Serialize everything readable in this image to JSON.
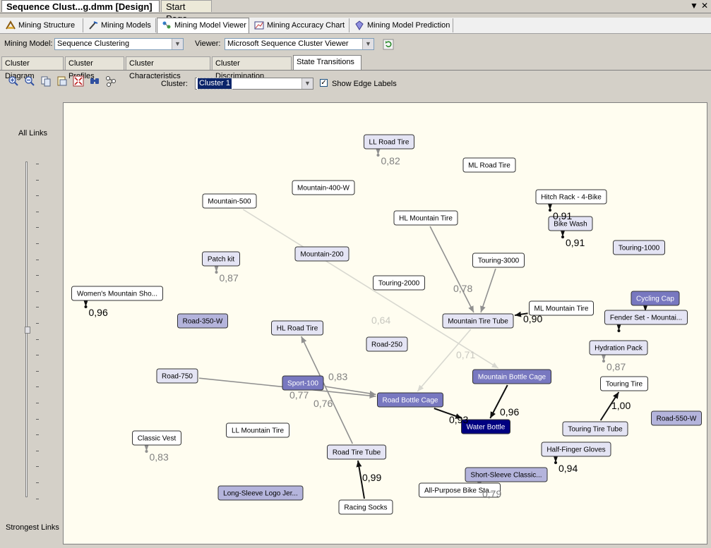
{
  "doc_tabs": {
    "active": "Sequence Clust...g.dmm [Design]",
    "inactive": "Start Page",
    "dropdown_glyph": "▼",
    "close_glyph": "✕"
  },
  "designer_tabs": [
    {
      "label": "Mining Structure",
      "icon": "mining-structure-icon"
    },
    {
      "label": "Mining Models",
      "icon": "mining-models-icon"
    },
    {
      "label": "Mining Model Viewer",
      "icon": "mining-model-viewer-icon"
    },
    {
      "label": "Mining Accuracy Chart",
      "icon": "accuracy-chart-icon"
    },
    {
      "label": "Mining Model Prediction",
      "icon": "prediction-icon"
    }
  ],
  "model_bar": {
    "model_label": "Mining Model:",
    "model_value": "Sequence Clustering",
    "viewer_label": "Viewer:",
    "viewer_value": "Microsoft Sequence Cluster Viewer"
  },
  "view_tabs": [
    "Cluster Diagram",
    "Cluster Profiles",
    "Cluster Characteristics",
    "Cluster Discrimination",
    "State Transitions"
  ],
  "toolbar": {
    "cluster_label": "Cluster:",
    "cluster_value": "Cluster 1",
    "show_edge_labels": "Show Edge Labels",
    "show_edge_labels_checked": true,
    "icons": [
      "zoom-in-icon",
      "zoom-out-icon",
      "copy-icon",
      "copy-selection-icon",
      "fit-to-window-icon",
      "find-node-icon",
      "layout-icon"
    ]
  },
  "links_slider": {
    "top_label": "All Links",
    "bottom_label": "Strongest Links",
    "level": 0.5
  },
  "colors": {
    "node_white": "#ffffff",
    "node_light": "#e4e4f4",
    "node_medium": "#b4b4dc",
    "node_strong": "#7878c0",
    "node_selected": "#000080",
    "edge_dark": "#101010",
    "edge_gray": "#909090",
    "edge_light": "#d8d8d0"
  },
  "nodes": [
    {
      "id": "ll-road-tire",
      "label": "LL Road Tire",
      "shade": "light"
    },
    {
      "id": "ml-road-tire",
      "label": "ML Road Tire",
      "shade": "white"
    },
    {
      "id": "mountain-400-w",
      "label": "Mountain-400-W",
      "shade": "white"
    },
    {
      "id": "mountain-500",
      "label": "Mountain-500",
      "shade": "white"
    },
    {
      "id": "hitch-rack",
      "label": "Hitch Rack - 4-Bike",
      "shade": "white"
    },
    {
      "id": "hl-mountain-tire",
      "label": "HL Mountain Tire",
      "shade": "white"
    },
    {
      "id": "bike-wash",
      "label": "Bike Wash",
      "shade": "light"
    },
    {
      "id": "touring-1000",
      "label": "Touring-1000",
      "shade": "light"
    },
    {
      "id": "patch-kit",
      "label": "Patch kit",
      "shade": "light"
    },
    {
      "id": "mountain-200",
      "label": "Mountain-200",
      "shade": "light"
    },
    {
      "id": "touring-3000",
      "label": "Touring-3000",
      "shade": "white"
    },
    {
      "id": "touring-2000",
      "label": "Touring-2000",
      "shade": "white"
    },
    {
      "id": "womens-mountain-shorts",
      "label": "Women's Mountain Sho...",
      "shade": "white"
    },
    {
      "id": "cycling-cap",
      "label": "Cycling Cap",
      "shade": "strong"
    },
    {
      "id": "ml-mountain-tire",
      "label": "ML Mountain Tire",
      "shade": "white"
    },
    {
      "id": "fender-set",
      "label": "Fender Set - Mountai...",
      "shade": "light"
    },
    {
      "id": "road-350-w",
      "label": "Road-350-W",
      "shade": "medium"
    },
    {
      "id": "hl-road-tire",
      "label": "HL Road Tire",
      "shade": "light"
    },
    {
      "id": "mountain-tire-tube",
      "label": "Mountain Tire Tube",
      "shade": "light"
    },
    {
      "id": "road-250",
      "label": "Road-250",
      "shade": "light"
    },
    {
      "id": "hydration-pack",
      "label": "Hydration Pack",
      "shade": "light"
    },
    {
      "id": "road-750",
      "label": "Road-750",
      "shade": "light"
    },
    {
      "id": "sport-100",
      "label": "Sport-100",
      "shade": "strong"
    },
    {
      "id": "mountain-bottle-cage",
      "label": "Mountain Bottle Cage",
      "shade": "strong"
    },
    {
      "id": "touring-tire",
      "label": "Touring Tire",
      "shade": "white"
    },
    {
      "id": "road-bottle-cage",
      "label": "Road Bottle Cage",
      "shade": "strong"
    },
    {
      "id": "water-bottle",
      "label": "Water Bottle",
      "shade": "selected"
    },
    {
      "id": "road-550-w",
      "label": "Road-550-W",
      "shade": "medium"
    },
    {
      "id": "classic-vest",
      "label": "Classic Vest",
      "shade": "white"
    },
    {
      "id": "ll-mountain-tire",
      "label": "LL Mountain Tire",
      "shade": "white"
    },
    {
      "id": "touring-tire-tube",
      "label": "Touring Tire Tube",
      "shade": "light"
    },
    {
      "id": "half-finger-gloves",
      "label": "Half-Finger Gloves",
      "shade": "light"
    },
    {
      "id": "road-tire-tube",
      "label": "Road Tire Tube",
      "shade": "light"
    },
    {
      "id": "short-sleeve-classic",
      "label": "Short-Sleeve Classic...",
      "shade": "medium"
    },
    {
      "id": "all-purpose-bike-stand",
      "label": "All-Purpose Bike Sta...",
      "shade": "white"
    },
    {
      "id": "long-sleeve-logo-jersey",
      "label": "Long-Sleeve Logo Jer...",
      "shade": "medium"
    },
    {
      "id": "racing-socks",
      "label": "Racing Socks",
      "shade": "white"
    }
  ],
  "edges": [
    {
      "from": "mountain-500",
      "to": "mountain-bottle-cage",
      "label": "0,71",
      "strength": "light"
    },
    {
      "from": "hl-mountain-tire",
      "to": "mountain-tire-tube",
      "label": "0,78",
      "strength": "gray"
    },
    {
      "from": "touring-3000",
      "to": "mountain-tire-tube",
      "label": "",
      "strength": "gray"
    },
    {
      "from": "ml-mountain-tire",
      "to": "mountain-tire-tube",
      "label": "0,90",
      "strength": "dark"
    },
    {
      "from": "mountain-tire-tube",
      "to": "road-bottle-cage",
      "label": "0,64",
      "strength": "light"
    },
    {
      "from": "road-750",
      "to": "road-bottle-cage",
      "label": "0,77",
      "strength": "gray"
    },
    {
      "from": "sport-100",
      "to": "road-bottle-cage",
      "label": "0,76",
      "strength": "gray"
    },
    {
      "from": "road-tire-tube",
      "to": "hl-road-tire",
      "label": "0,83",
      "strength": "gray"
    },
    {
      "from": "racing-socks",
      "to": "road-tire-tube",
      "label": "0,99",
      "strength": "dark"
    },
    {
      "from": "road-bottle-cage",
      "to": "water-bottle",
      "label": "0,93",
      "strength": "dark"
    },
    {
      "from": "mountain-bottle-cage",
      "to": "water-bottle",
      "label": "0,96",
      "strength": "dark"
    },
    {
      "from": "touring-tire-tube",
      "to": "touring-tire",
      "label": "1,00",
      "strength": "dark"
    }
  ],
  "self_loops": [
    {
      "node": "ll-road-tire",
      "label": "0,82",
      "strength": "gray"
    },
    {
      "node": "hitch-rack",
      "label": "0,91",
      "strength": "dark"
    },
    {
      "node": "bike-wash",
      "label": "0,91",
      "strength": "dark"
    },
    {
      "node": "patch-kit",
      "label": "0,87",
      "strength": "gray"
    },
    {
      "node": "womens-mountain-shorts",
      "label": "0,96",
      "strength": "dark"
    },
    {
      "node": "hydration-pack",
      "label": "0,87",
      "strength": "gray"
    },
    {
      "node": "classic-vest",
      "label": "0,83",
      "strength": "gray"
    },
    {
      "node": "half-finger-gloves",
      "label": "0,94",
      "strength": "dark"
    },
    {
      "node": "short-sleeve-classic",
      "label": "0,79",
      "strength": "gray"
    },
    {
      "node": "cycling-cap",
      "label": "",
      "strength": "dark"
    },
    {
      "node": "fender-set",
      "label": "",
      "strength": "dark"
    }
  ]
}
